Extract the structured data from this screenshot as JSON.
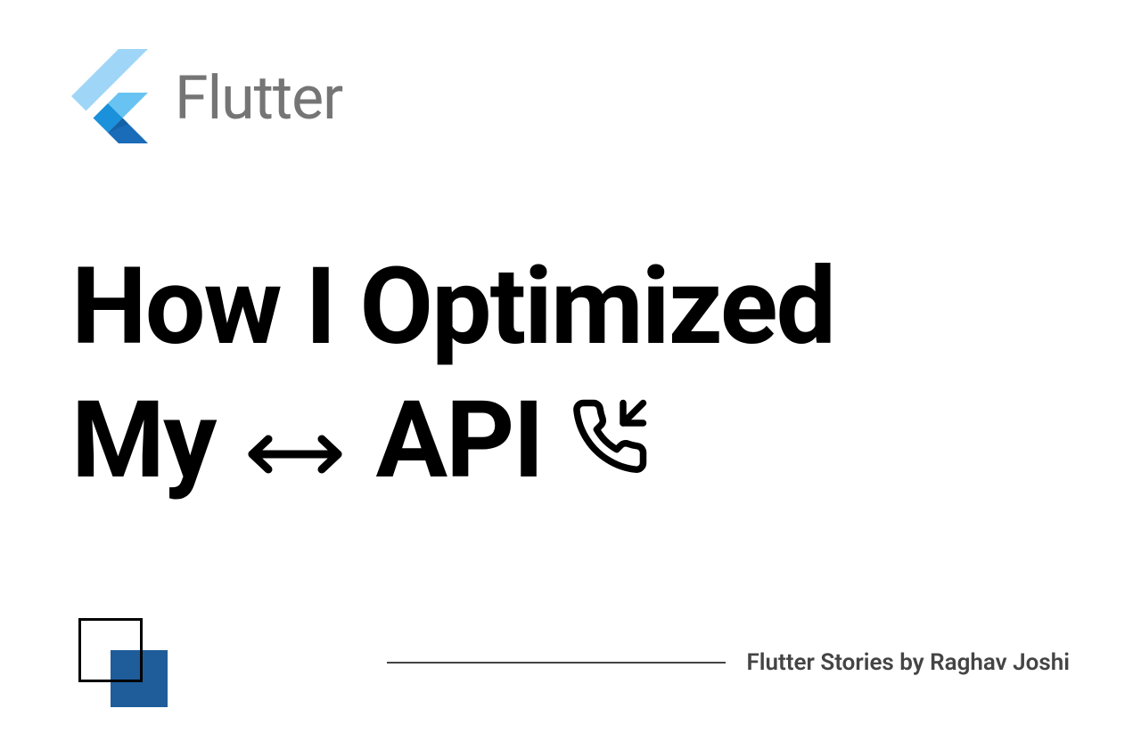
{
  "logo": {
    "text": "Flutter"
  },
  "title": {
    "line1": "How I Optimized",
    "word_my": "My",
    "word_api": "API"
  },
  "footer": {
    "byline": "Flutter Stories by Raghav Joshi"
  }
}
